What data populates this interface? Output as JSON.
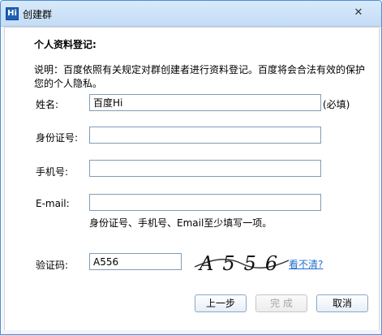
{
  "window": {
    "title": "创建群",
    "app_icon_text": "Hi"
  },
  "form": {
    "heading": "个人资料登记:",
    "note": "说明：百度依照有关规定对群创建者进行资料登记。百度将会合法有效的保护您的个人隐私。",
    "name": {
      "label": "姓名:",
      "value": "百度Hi",
      "required": "(必填)"
    },
    "id_card": {
      "label": "身份证号:",
      "value": ""
    },
    "phone": {
      "label": "手机号:",
      "value": ""
    },
    "email": {
      "label": "E-mail:",
      "value": ""
    },
    "hint": "身份证号、手机号、Email至少填写一项。",
    "captcha": {
      "label": "验证码:",
      "value": "A556",
      "image_text": "A556",
      "refresh_link": "看不清?"
    }
  },
  "buttons": {
    "prev": "上一步",
    "finish": "完 成",
    "cancel": "取消"
  }
}
